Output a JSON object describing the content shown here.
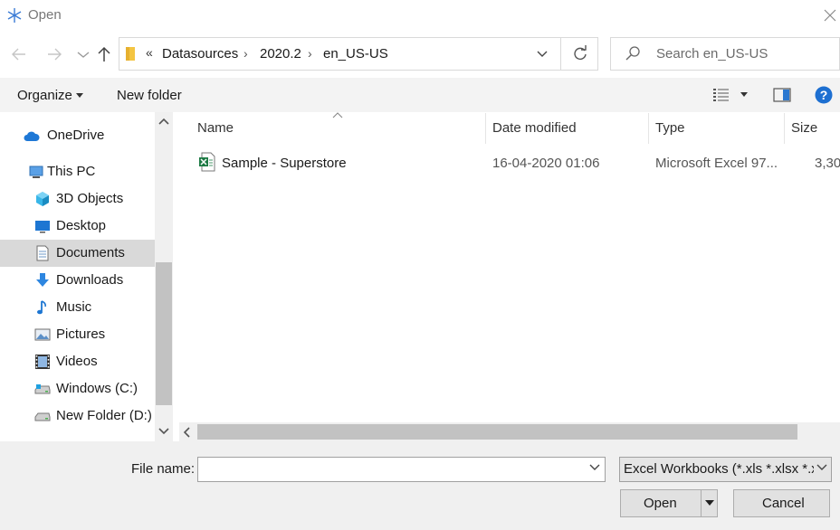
{
  "window": {
    "title": "Open"
  },
  "address": {
    "overflow": "«",
    "crumbs": [
      "Datasources",
      "2020.2",
      "en_US-US"
    ],
    "separator": "›"
  },
  "search": {
    "placeholder": "Search en_US-US",
    "value": ""
  },
  "toolbar": {
    "organize_label": "Organize",
    "new_folder_label": "New folder"
  },
  "nav": {
    "items": [
      {
        "label": "OneDrive",
        "icon": "cloud-icon"
      },
      {
        "label": "This PC",
        "icon": "computer-icon"
      },
      {
        "label": "3D Objects",
        "icon": "cube-icon"
      },
      {
        "label": "Desktop",
        "icon": "desktop-icon"
      },
      {
        "label": "Documents",
        "icon": "document-icon",
        "selected": true
      },
      {
        "label": "Downloads",
        "icon": "download-arrow-icon"
      },
      {
        "label": "Music",
        "icon": "music-note-icon"
      },
      {
        "label": "Pictures",
        "icon": "picture-icon"
      },
      {
        "label": "Videos",
        "icon": "film-icon"
      },
      {
        "label": "Windows (C:)",
        "icon": "drive-icon"
      },
      {
        "label": "New Folder (D:)",
        "icon": "drive-icon"
      }
    ]
  },
  "columns": {
    "name": "Name",
    "date": "Date modified",
    "type": "Type",
    "size": "Size"
  },
  "files": [
    {
      "name": "Sample - Superstore",
      "date": "16-04-2020 01:06",
      "type": "Microsoft Excel 97...",
      "size": "3,30",
      "icon": "excel-file-icon"
    }
  ],
  "footer": {
    "file_name_label": "File name:",
    "file_name_value": "",
    "file_type": "Excel Workbooks (*.xls *.xlsx *.xl",
    "open_label": "Open",
    "cancel_label": "Cancel"
  },
  "colors": {
    "accent": "#0078d7",
    "selected": "#d9d9d9",
    "excel_green": "#1d7a44"
  }
}
